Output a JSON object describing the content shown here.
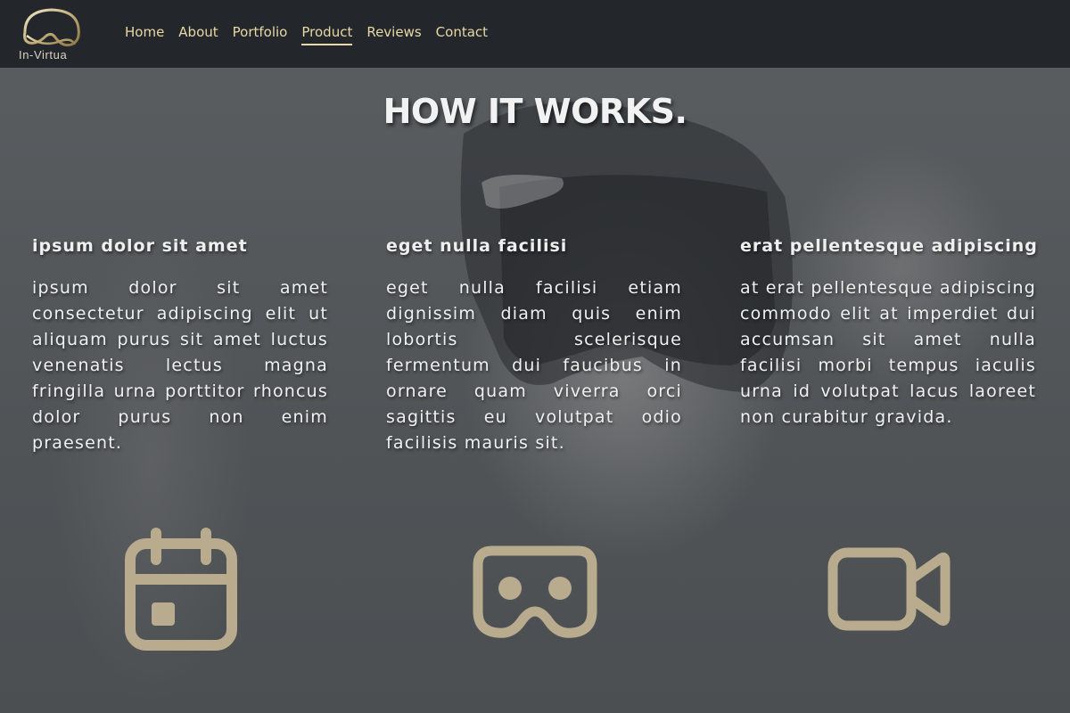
{
  "brand": {
    "logo_text": "In-Virtua",
    "logo_icon": "vr-headset-logo",
    "accent_color": "#e9d7a5",
    "nav_bg_color": "#23272b",
    "icon_color": "#b8ab8e"
  },
  "nav": {
    "items": [
      {
        "label": "Home"
      },
      {
        "label": "About"
      },
      {
        "label": "Portfolio"
      },
      {
        "label": "Product",
        "active": true
      },
      {
        "label": "Reviews"
      },
      {
        "label": "Contact"
      }
    ]
  },
  "section": {
    "title": "HOW IT WORKS."
  },
  "features": [
    {
      "heading": "ipsum dolor sit amet",
      "body": "ipsum dolor sit amet consectetur adipiscing elit ut aliquam purus sit amet luctus venenatis lectus magna fringilla urna porttitor rhoncus dolor purus non enim praesent.",
      "icon": "calendar-icon"
    },
    {
      "heading": "eget nulla facilisi",
      "body": "eget nulla facilisi etiam dignissim diam quis enim lobortis scelerisque fermentum dui faucibus in ornare quam viverra orci sagittis eu volutpat odio facilisis mauris sit.",
      "icon": "vr-headset-icon"
    },
    {
      "heading": "erat pellentesque adipiscing",
      "body": "at erat pellentesque adipiscing commodo elit at imperdiet dui accumsan sit amet nulla facilisi morbi tempus iaculis urna id volutpat lacus laoreet non curabitur gravida.",
      "icon": "video-camera-icon"
    }
  ]
}
